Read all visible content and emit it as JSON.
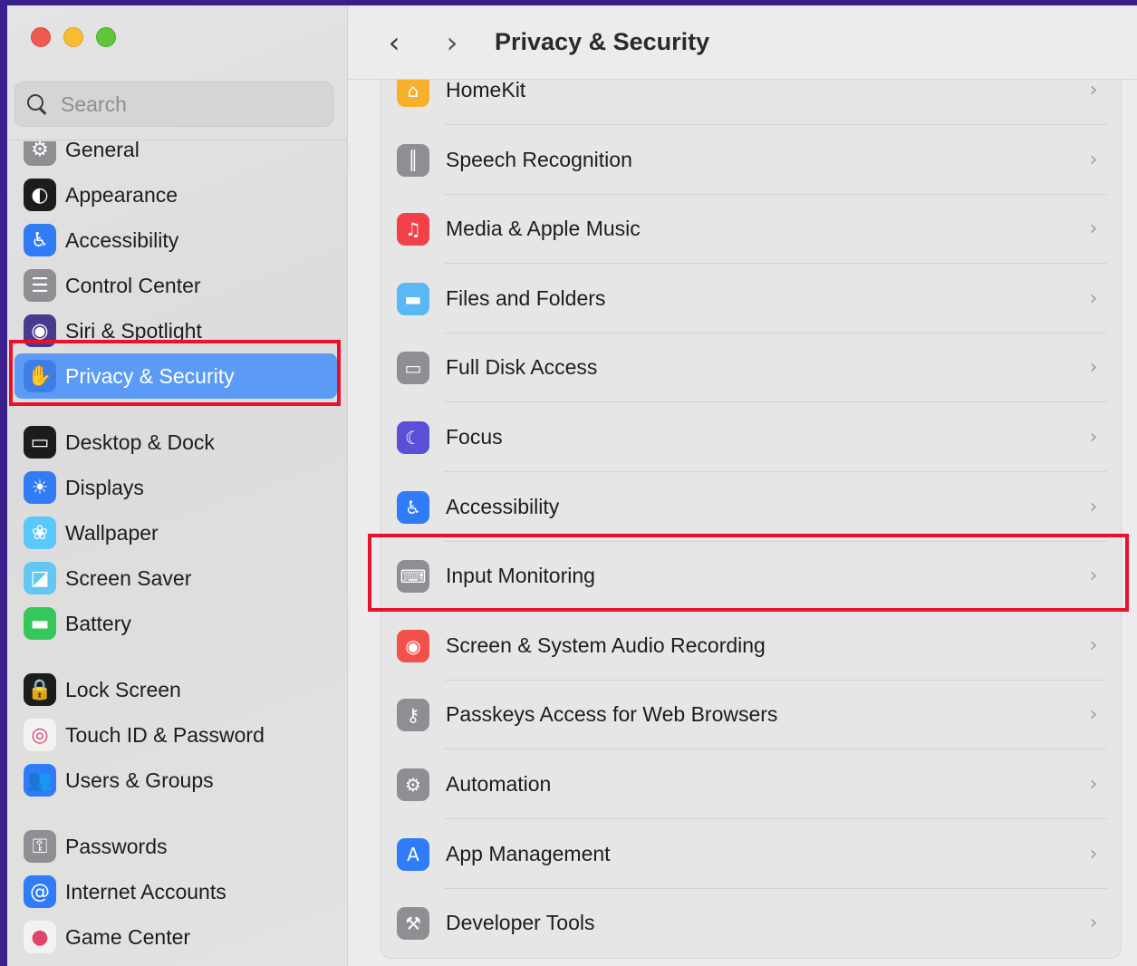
{
  "window": {
    "title": "Privacy & Security",
    "nav_back": "‹",
    "nav_forward": "›"
  },
  "search": {
    "placeholder": "Search"
  },
  "sidebar": {
    "items": [
      {
        "label": "General",
        "icon": "gear-icon",
        "glyph": "⚙",
        "color": "#8e8e93"
      },
      {
        "label": "Appearance",
        "icon": "appearance-icon",
        "glyph": "◐",
        "color": "#1c1c1e"
      },
      {
        "label": "Accessibility",
        "icon": "accessibility-icon",
        "glyph": "♿",
        "color": "#2f7cf6"
      },
      {
        "label": "Control Center",
        "icon": "control-center-icon",
        "glyph": "☰",
        "color": "#8e8e93"
      },
      {
        "label": "Siri & Spotlight",
        "icon": "siri-icon",
        "glyph": "◉",
        "color": "#4a3a8e"
      },
      {
        "label": "Privacy & Security",
        "icon": "hand-icon",
        "glyph": "✋",
        "color": "#3f7ee6",
        "selected": true
      },
      {
        "label": "Desktop & Dock",
        "icon": "dock-icon",
        "glyph": "▭",
        "color": "#1c1c1e"
      },
      {
        "label": "Displays",
        "icon": "displays-icon",
        "glyph": "☀",
        "color": "#2f7cf6"
      },
      {
        "label": "Wallpaper",
        "icon": "wallpaper-icon",
        "glyph": "❀",
        "color": "#5ac8fa"
      },
      {
        "label": "Screen Saver",
        "icon": "screen-saver-icon",
        "glyph": "◪",
        "color": "#63c7f0"
      },
      {
        "label": "Battery",
        "icon": "battery-icon",
        "glyph": "▬",
        "color": "#34c759"
      },
      {
        "label": "Lock Screen",
        "icon": "lock-icon",
        "glyph": "🔒",
        "color": "#1c1c1e"
      },
      {
        "label": "Touch ID & Password",
        "icon": "fingerprint-icon",
        "glyph": "◎",
        "color": "#f2f2f2"
      },
      {
        "label": "Users & Groups",
        "icon": "users-icon",
        "glyph": "👥",
        "color": "#2f7cf6"
      },
      {
        "label": "Passwords",
        "icon": "key-icon",
        "glyph": "⚿",
        "color": "#8e8e93"
      },
      {
        "label": "Internet Accounts",
        "icon": "at-icon",
        "glyph": "@",
        "color": "#2f7cf6"
      },
      {
        "label": "Game Center",
        "icon": "game-center-icon",
        "glyph": "●",
        "color": "#f2f2f2"
      }
    ]
  },
  "main": {
    "rows": [
      {
        "label": "HomeKit",
        "icon": "home-icon",
        "glyph": "⌂",
        "color": "#f5b12b"
      },
      {
        "label": "Speech Recognition",
        "icon": "waveform-icon",
        "glyph": "║",
        "color": "#8e8e93"
      },
      {
        "label": "Media & Apple Music",
        "icon": "music-icon",
        "glyph": "♫",
        "color": "#f2404b"
      },
      {
        "label": "Files and Folders",
        "icon": "folder-icon",
        "glyph": "▬",
        "color": "#5ab9f5"
      },
      {
        "label": "Full Disk Access",
        "icon": "disk-icon",
        "glyph": "▭",
        "color": "#8e8e93"
      },
      {
        "label": "Focus",
        "icon": "moon-icon",
        "glyph": "☾",
        "color": "#5a4fd6"
      },
      {
        "label": "Accessibility",
        "icon": "accessibility-icon",
        "glyph": "♿",
        "color": "#2f7cf6"
      },
      {
        "label": "Input Monitoring",
        "icon": "keyboard-icon",
        "glyph": "⌨",
        "color": "#8e8e93"
      },
      {
        "label": "Screen & System Audio Recording",
        "icon": "record-icon",
        "glyph": "◉",
        "color": "#f2504b"
      },
      {
        "label": "Passkeys Access for Web Browsers",
        "icon": "passkey-icon",
        "glyph": "⚷",
        "color": "#8e8e93"
      },
      {
        "label": "Automation",
        "icon": "gears-icon",
        "glyph": "⚙",
        "color": "#8e8e93"
      },
      {
        "label": "App Management",
        "icon": "app-store-icon",
        "glyph": "A",
        "color": "#2f7cf6"
      },
      {
        "label": "Developer Tools",
        "icon": "hammer-icon",
        "glyph": "⚒",
        "color": "#8e8e93"
      }
    ],
    "chevron": "›"
  },
  "colors": {
    "accent": "#5b9bf5",
    "highlight": "#e8122d",
    "background": "#3b1f8c"
  }
}
